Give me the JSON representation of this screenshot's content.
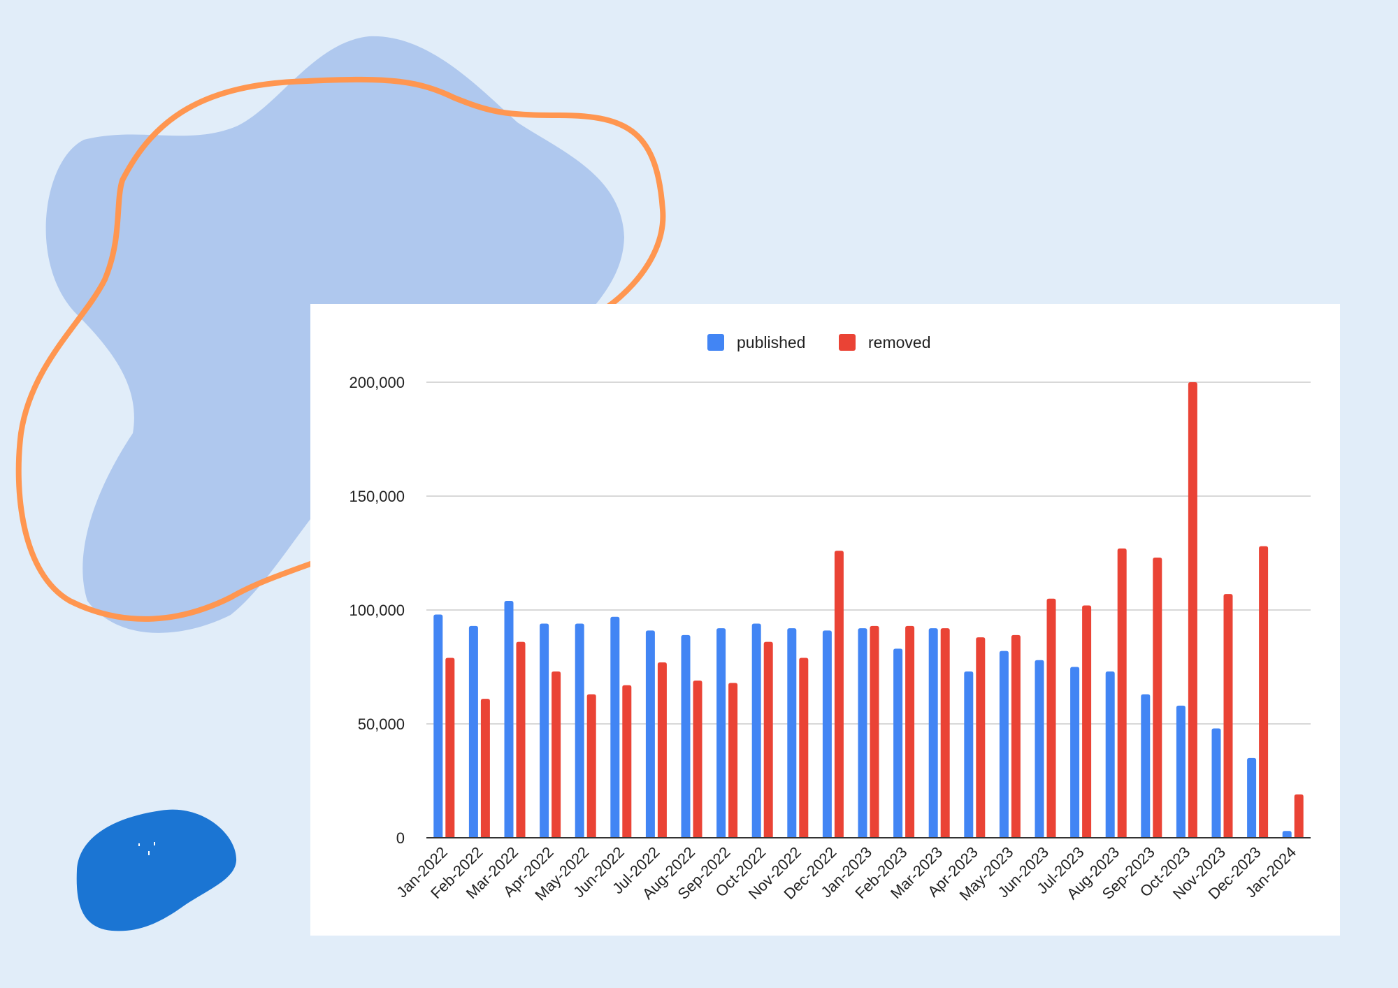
{
  "decor": {
    "blob_color": "#afc8ee",
    "outline_color": "#ff9650",
    "small_blob_color": "#1b75d3"
  },
  "chart_data": {
    "type": "bar",
    "categories": [
      "Jan-2022",
      "Feb-2022",
      "Mar-2022",
      "Apr-2022",
      "May-2022",
      "Jun-2022",
      "Jul-2022",
      "Aug-2022",
      "Sep-2022",
      "Oct-2022",
      "Nov-2022",
      "Dec-2022",
      "Jan-2023",
      "Feb-2023",
      "Mar-2023",
      "Apr-2023",
      "May-2023",
      "Jun-2023",
      "Jul-2023",
      "Aug-2023",
      "Sep-2023",
      "Oct-2023",
      "Nov-2023",
      "Dec-2023",
      "Jan-2024"
    ],
    "series": [
      {
        "name": "published",
        "color": "#4285f4",
        "values": [
          98000,
          93000,
          104000,
          94000,
          94000,
          97000,
          91000,
          89000,
          92000,
          94000,
          92000,
          91000,
          92000,
          83000,
          92000,
          73000,
          82000,
          78000,
          75000,
          73000,
          63000,
          58000,
          48000,
          35000,
          3000
        ]
      },
      {
        "name": "removed",
        "color": "#ea4335",
        "values": [
          79000,
          61000,
          86000,
          73000,
          63000,
          67000,
          77000,
          69000,
          68000,
          86000,
          79000,
          126000,
          93000,
          93000,
          92000,
          88000,
          89000,
          105000,
          102000,
          127000,
          123000,
          200000,
          107000,
          128000,
          19000
        ]
      }
    ],
    "ylim": [
      0,
      200000
    ],
    "yticks": [
      0,
      50000,
      100000,
      150000,
      200000
    ],
    "ytick_labels": [
      "0",
      "50,000",
      "100,000",
      "150,000",
      "200,000"
    ],
    "grid": true,
    "legend": "top"
  }
}
